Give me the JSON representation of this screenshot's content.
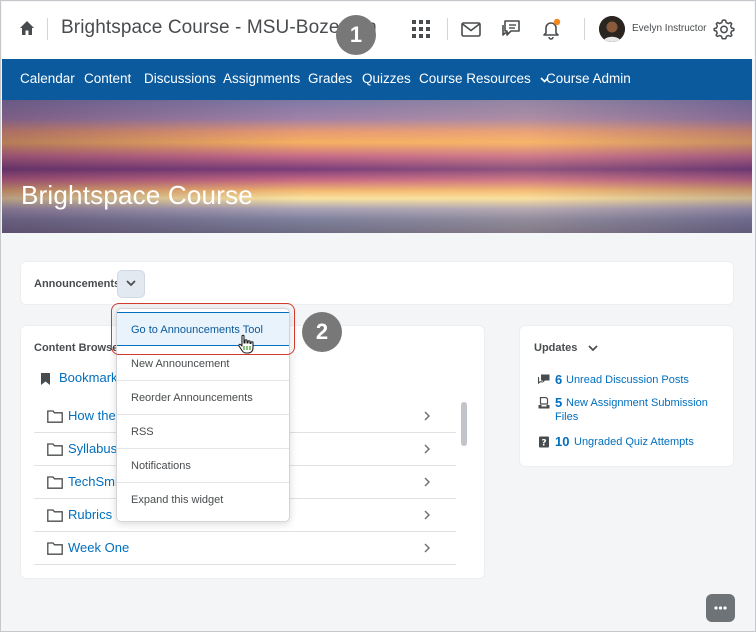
{
  "header": {
    "course_title": "Brightspace Course - MSU-Bozeman",
    "callout_1": "1",
    "user_name": "Evelyn Instructor"
  },
  "nav": {
    "items": [
      "Calendar",
      "Content",
      "Discussions",
      "Assignments",
      "Grades",
      "Quizzes",
      "Course Resources",
      "Course Admin"
    ]
  },
  "banner": {
    "title": "Brightspace Course"
  },
  "announcements": {
    "title": "Announcements"
  },
  "menu": {
    "items": [
      "Go to Announcements Tool",
      "New Announcement",
      "Reorder Announcements",
      "RSS",
      "Notifications",
      "Expand this widget"
    ],
    "callout_2": "2"
  },
  "content_browser": {
    "title": "Content Browser",
    "bookmark_label": "Bookmarks",
    "rows": [
      "How the",
      "Syllabus",
      "TechSmith",
      "Rubrics",
      "Week One"
    ]
  },
  "updates": {
    "title": "Updates",
    "items": [
      {
        "count": "6",
        "text": "Unread Discussion Posts",
        "text2": ""
      },
      {
        "count": "5",
        "text": "New Assignment Submission",
        "text2": "Files"
      },
      {
        "count": "10",
        "text": "Ungraded Quiz Attempts",
        "text2": ""
      }
    ]
  },
  "colors": {
    "nav_blue": "#0b5a9e",
    "link_blue": "#006fbf",
    "callout_gray": "#787878",
    "highlight_red": "#d23a2e",
    "notification_orange": "#f0881e"
  }
}
